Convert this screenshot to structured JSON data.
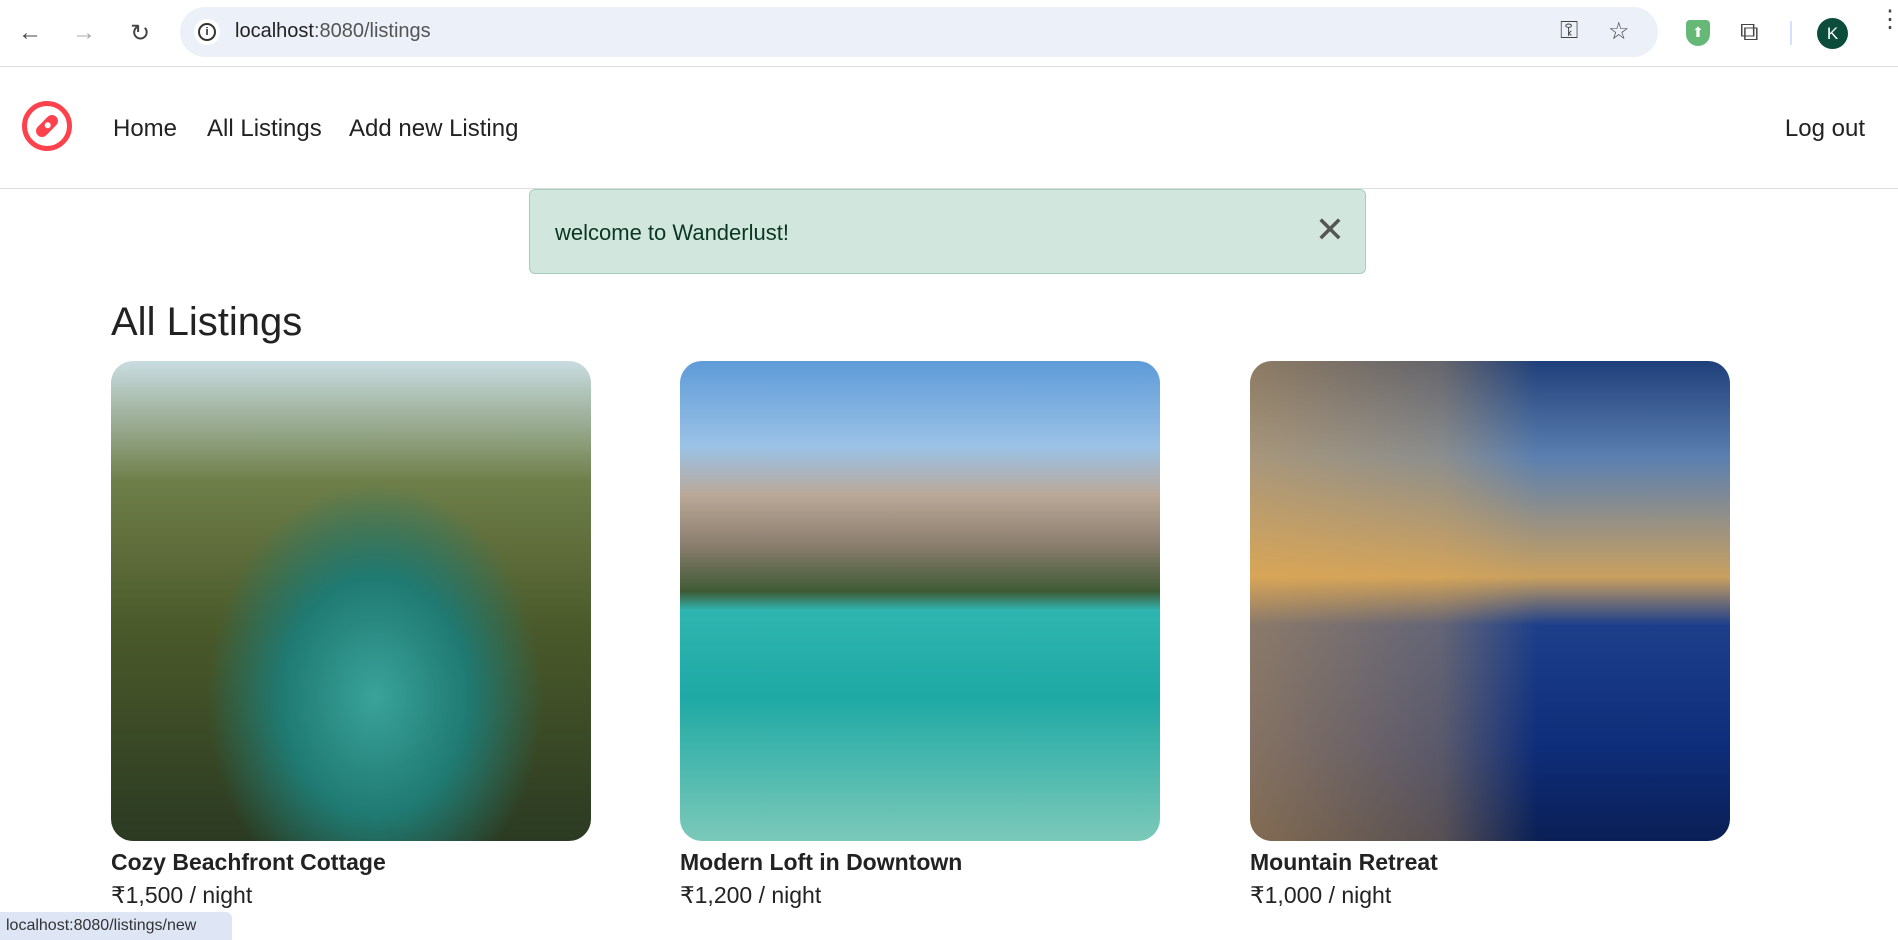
{
  "browser": {
    "url_host": "localhost",
    "url_rest": ":8080/listings",
    "avatar_letter": "K"
  },
  "nav": {
    "home": "Home",
    "all_listings": "All Listings",
    "add_new": "Add new Listing",
    "logout": "Log out"
  },
  "alert": {
    "message": "welcome to Wanderlust!"
  },
  "page_title": "All Listings",
  "listings": [
    {
      "title": "Cozy Beachfront Cottage",
      "price": "₹1,500 / night"
    },
    {
      "title": "Modern Loft in Downtown",
      "price": "₹1,200 / night"
    },
    {
      "title": "Mountain Retreat",
      "price": "₹1,000 / night"
    }
  ],
  "status_bar": "localhost:8080/listings/new"
}
